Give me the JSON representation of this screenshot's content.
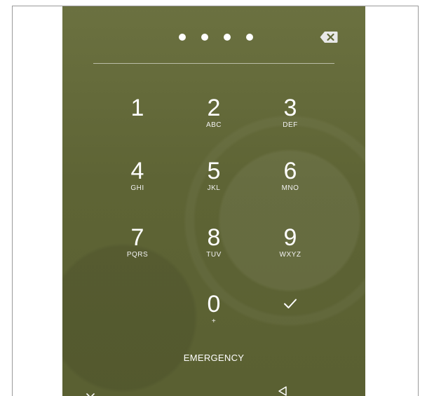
{
  "pin": {
    "entered_digits": 4
  },
  "icons": {
    "backspace": "backspace-icon",
    "enter": "checkmark-icon",
    "nav_down": "chevron-down-icon",
    "nav_back": "back-triangle-icon"
  },
  "keypad": {
    "keys": [
      {
        "digit": "1",
        "letters": ""
      },
      {
        "digit": "2",
        "letters": "ABC"
      },
      {
        "digit": "3",
        "letters": "DEF"
      },
      {
        "digit": "4",
        "letters": "GHI"
      },
      {
        "digit": "5",
        "letters": "JKL"
      },
      {
        "digit": "6",
        "letters": "MNO"
      },
      {
        "digit": "7",
        "letters": "PQRS"
      },
      {
        "digit": "8",
        "letters": "TUV"
      },
      {
        "digit": "9",
        "letters": "WXYZ"
      },
      {
        "digit": "0",
        "letters": "+"
      }
    ]
  },
  "emergency": {
    "label": "EMERGENCY"
  },
  "colors": {
    "background": "#5f6636",
    "foreground": "#ffffff"
  }
}
